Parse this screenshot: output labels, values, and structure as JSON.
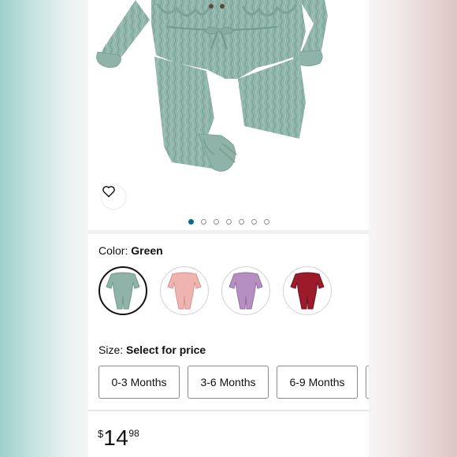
{
  "product": {
    "image_count": 7,
    "active_image_index": 0
  },
  "color": {
    "label": "Color:",
    "selected": "Green",
    "options": [
      {
        "name": "Green",
        "hex": "#8fb3a8",
        "selected": true
      },
      {
        "name": "Pink",
        "hex": "#f0b4b0",
        "selected": false
      },
      {
        "name": "Purple",
        "hex": "#b58fc1",
        "selected": false
      },
      {
        "name": "Burgundy",
        "hex": "#9b1b2a",
        "selected": false
      }
    ]
  },
  "size": {
    "label": "Size:",
    "prompt": "Select for price",
    "options": [
      "0-3 Months",
      "3-6 Months",
      "6-9 Months"
    ]
  },
  "price": {
    "symbol": "$",
    "whole": "14",
    "fraction": "98"
  },
  "icons": {
    "wishlist": "heart-icon"
  },
  "colors": {
    "accent": "#007185",
    "text": "#0f1111",
    "border": "#888c8c"
  }
}
